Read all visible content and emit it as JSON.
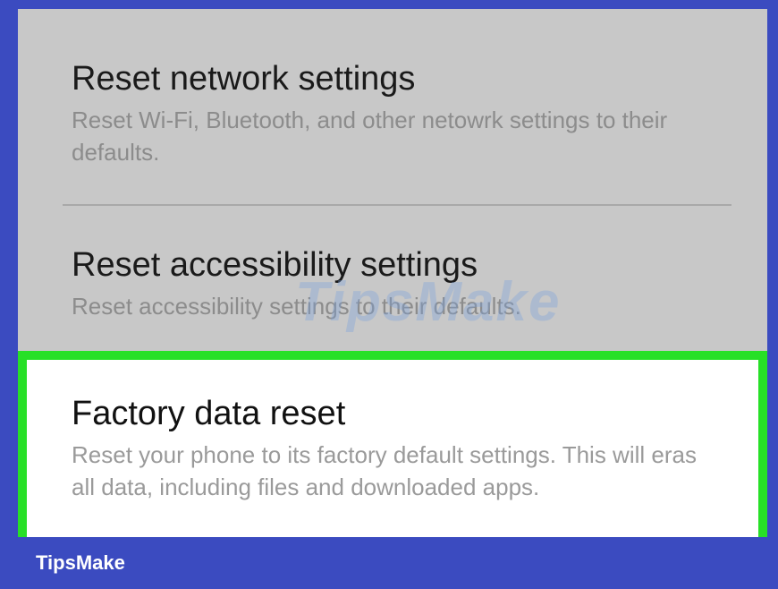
{
  "settings": {
    "network": {
      "title": "Reset network settings",
      "description": "Reset Wi-Fi, Bluetooth, and other netowrk settings to their defaults."
    },
    "accessibility": {
      "title": "Reset accessibility settings",
      "description": "Reset accessibility settings to their defaults."
    },
    "factory": {
      "title": "Factory data reset",
      "description": "Reset your phone to its factory default settings. This will eras all data, including files and downloaded apps."
    }
  },
  "watermark": "TipsMake",
  "footer": {
    "brand": "TipsMake"
  },
  "colors": {
    "frame_blue": "#3b4bc0",
    "highlight_green": "#27e027",
    "dimmed_background": "#c8c8c8"
  }
}
